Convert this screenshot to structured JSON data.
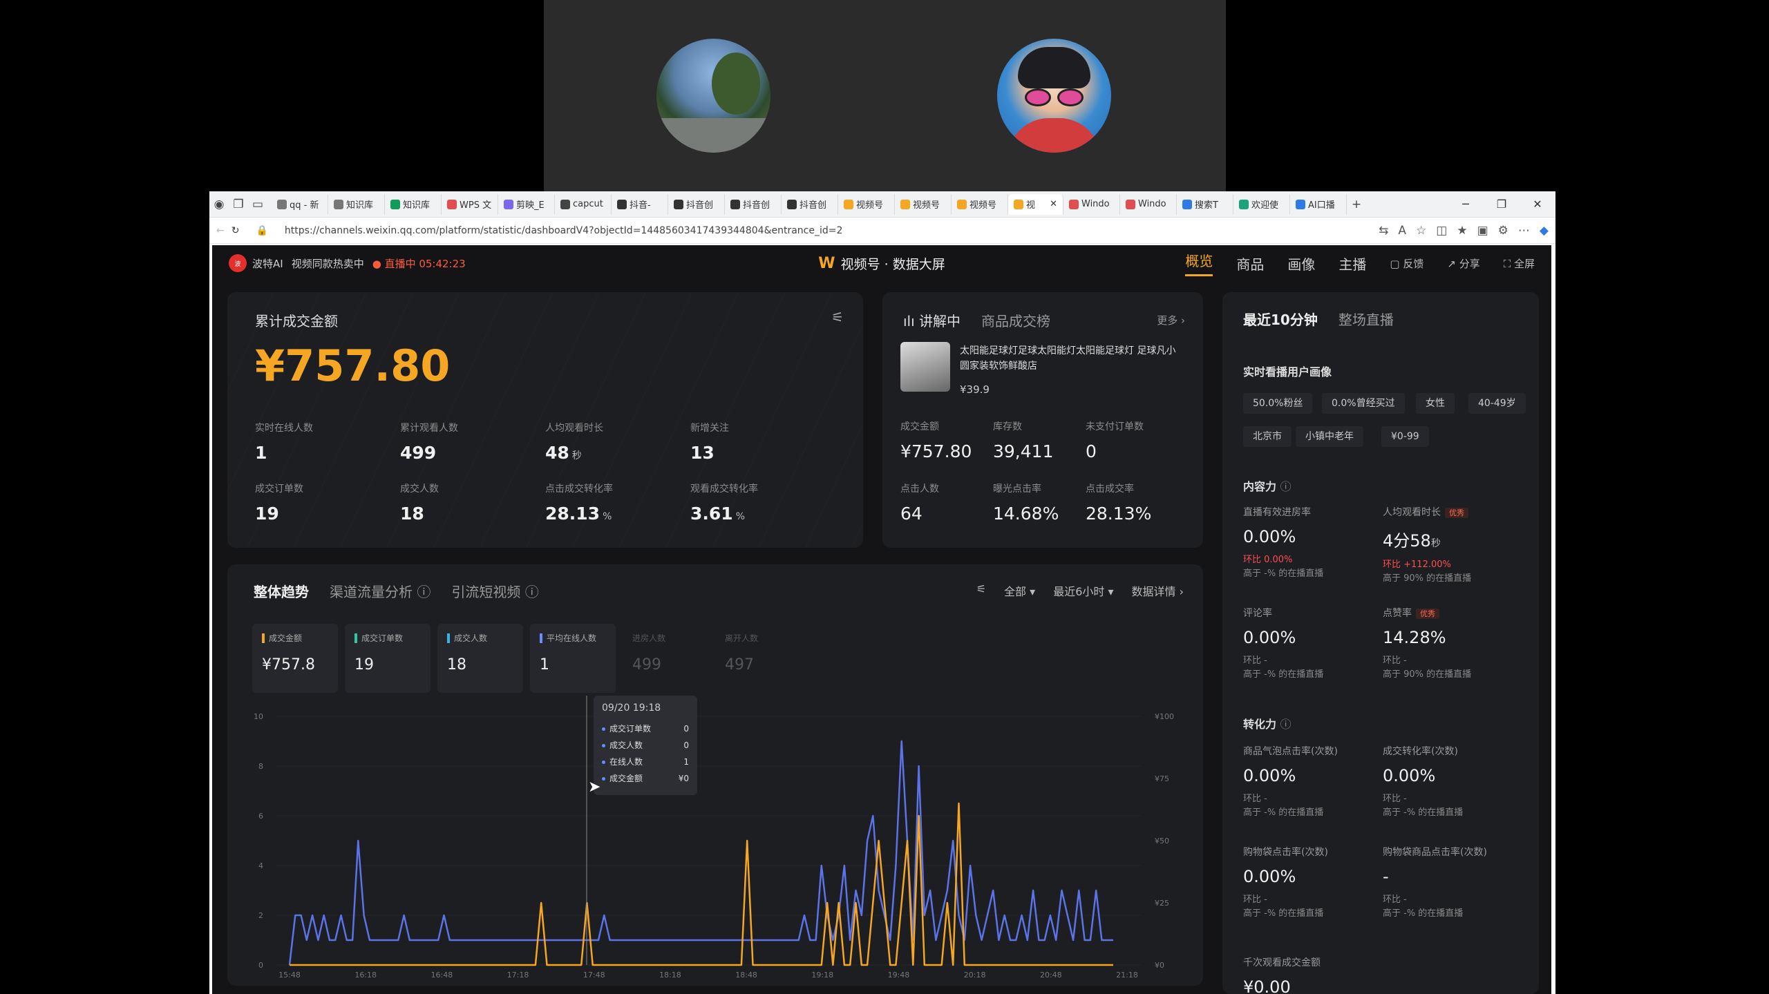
{
  "browser": {
    "tabs": [
      "qq - 新",
      "知识库",
      "知识库",
      "WPS 文",
      "剪映_E",
      "capcut",
      "抖音-",
      "抖音创",
      "抖音创",
      "抖音创",
      "视频号",
      "视频号",
      "视频号",
      "视",
      "Windo",
      "Windo",
      "搜索T",
      "欢迎使",
      "AI口播"
    ],
    "url": "https://channels.weixin.qq.com/platform/statistic/dashboardV4?objectId=14485603417439344804&entrance_id=2"
  },
  "topnav": {
    "brand": "波特AI",
    "status": "视频同款热卖中",
    "live": "直播中 05:42:23",
    "center_title": "视频号 · 数据大屏",
    "nav": [
      "概览",
      "商品",
      "画像",
      "主播"
    ],
    "actions": [
      "反馈",
      "分享",
      "全屏"
    ]
  },
  "sales": {
    "title": "累计成交金额",
    "amount": "¥757.80",
    "metrics": [
      {
        "label": "实时在线人数",
        "value": "1",
        "unit": ""
      },
      {
        "label": "累计观看人数",
        "value": "499",
        "unit": ""
      },
      {
        "label": "人均观看时长",
        "value": "48",
        "unit": "秒"
      },
      {
        "label": "新增关注",
        "value": "13",
        "unit": ""
      },
      {
        "label": "成交订单数",
        "value": "19",
        "unit": ""
      },
      {
        "label": "成交人数",
        "value": "18",
        "unit": ""
      },
      {
        "label": "点击成交转化率",
        "value": "28.13",
        "unit": "%"
      },
      {
        "label": "观看成交转化率",
        "value": "3.61",
        "unit": "%"
      }
    ]
  },
  "product": {
    "tab_active": "讲解中",
    "tab_inactive": "商品成交榜",
    "more": "更多",
    "name": "太阳能足球灯足球太阳能灯太阳能足球灯 足球凡小圆家装软饰鲜酸店",
    "price": "¥39.9",
    "stats": [
      {
        "label": "成交金额",
        "value": "¥757.80"
      },
      {
        "label": "库存数",
        "value": "39,411"
      },
      {
        "label": "未支付订单数",
        "value": "0"
      },
      {
        "label": "点击人数",
        "value": "64"
      },
      {
        "label": "曝光点击率",
        "value": "14.68%"
      },
      {
        "label": "点击成交率",
        "value": "28.13%"
      }
    ]
  },
  "live": {
    "tab_active": "最近10分钟",
    "tab_inactive": "整场直播",
    "portrait_title": "实时看播用户画像",
    "chips": [
      "50.0%粉丝",
      "0.0%曾经买过",
      "女性",
      "40-49岁",
      "北京市",
      "小镇中老年",
      "¥0-99"
    ],
    "content_title": "内容力",
    "content": [
      {
        "label": "直播有效进房率",
        "badge": "",
        "value": "0.00%",
        "unit": "",
        "ring": "环比 0.00%",
        "rank": "高于 -% 的在播直播"
      },
      {
        "label": "人均观看时长",
        "badge": "优秀",
        "value": "4分58",
        "unit": "秒",
        "ring": "环比 +112.00%",
        "rank": "高于 90% 的在播直播"
      },
      {
        "label": "评论率",
        "badge": "",
        "value": "0.00%",
        "unit": "",
        "ring": "环比 -",
        "rank": "高于 -% 的在播直播"
      },
      {
        "label": "点赞率",
        "badge": "优秀",
        "value": "14.28%",
        "unit": "",
        "ring": "环比 -",
        "rank": "高于 90% 的在播直播"
      }
    ],
    "convert_title": "转化力",
    "convert": [
      {
        "label": "商品气泡点击率(次数)",
        "value": "0.00%",
        "ring": "环比 -",
        "rank": "高于 -% 的在播直播"
      },
      {
        "label": "成交转化率(次数)",
        "value": "0.00%",
        "ring": "环比 -",
        "rank": "高于 -% 的在播直播"
      },
      {
        "label": "购物袋点击率(次数)",
        "value": "0.00%",
        "ring": "环比 -",
        "rank": "高于 -% 的在播直播"
      },
      {
        "label": "购物袋商品点击率(次数)",
        "value": "-",
        "ring": "环比 -",
        "rank": "高于 -% 的在播直播"
      }
    ],
    "bottom_label": "千次观看成交金额",
    "bottom_value": "¥0.00"
  },
  "trend": {
    "tabs": [
      "整体趋势",
      "渠道流量分析",
      "引流短视频"
    ],
    "ctrls": [
      "全部",
      "最近6小时",
      "数据详情"
    ],
    "cards": [
      {
        "label": "成交金额",
        "value": "¥757.8",
        "color": "#f5a623"
      },
      {
        "label": "成交订单数",
        "value": "19",
        "color": "#2ec7a4"
      },
      {
        "label": "成交人数",
        "value": "18",
        "color": "#33b5e5"
      },
      {
        "label": "平均在线人数",
        "value": "1",
        "color": "#6a8cff"
      },
      {
        "label": "进房人数",
        "value": "499",
        "color": ""
      },
      {
        "label": "离开人数",
        "value": "497",
        "color": ""
      }
    ],
    "tooltip": {
      "time": "09/20 19:18",
      "rows": [
        {
          "label": "成交订单数",
          "value": "0"
        },
        {
          "label": "成交人数",
          "value": "0"
        },
        {
          "label": "在线人数",
          "value": "1"
        },
        {
          "label": "成交金额",
          "value": "¥0"
        }
      ]
    }
  },
  "chart_data": {
    "type": "line",
    "x": [
      "15:48",
      "16:18",
      "16:48",
      "17:18",
      "17:48",
      "18:18",
      "18:48",
      "19:18",
      "19:48",
      "20:18",
      "20:48",
      "21:18"
    ],
    "ylim_left": [
      0,
      10
    ],
    "yticks_left": [
      0,
      2,
      4,
      6,
      8,
      10
    ],
    "ylim_right": [
      0,
      100
    ],
    "yticks_right": [
      "¥0",
      "¥25",
      "¥50",
      "¥75",
      "¥100"
    ],
    "series": [
      {
        "name": "平均在线人数",
        "axis": "left",
        "color": "#5b73e8",
        "values": [
          0,
          2,
          2,
          1,
          2,
          1,
          2,
          1,
          1,
          2,
          1,
          1,
          5,
          2,
          1,
          1,
          1,
          1,
          1,
          1,
          2,
          1,
          1,
          1,
          1,
          1,
          1,
          2,
          1,
          1,
          1,
          1,
          1,
          1,
          1,
          1,
          1,
          1,
          1,
          1,
          1,
          1,
          1,
          1,
          1,
          1,
          1,
          1,
          1,
          1,
          1,
          1,
          1,
          1,
          1,
          2,
          1,
          1,
          1,
          1,
          1,
          1,
          1,
          1,
          1,
          1,
          1,
          1,
          1,
          1,
          1,
          1,
          1,
          1,
          1,
          1,
          1,
          1,
          1,
          1,
          1,
          1,
          1,
          1,
          1,
          1,
          1,
          1,
          1,
          1,
          2,
          1,
          1,
          4,
          2,
          1,
          2,
          4,
          1,
          3,
          2,
          5,
          6,
          3,
          2,
          1,
          4,
          9,
          5,
          1,
          8,
          2,
          3,
          1,
          2,
          3,
          5,
          2,
          1,
          4,
          2,
          1,
          2,
          3,
          1,
          2,
          1,
          1,
          2,
          1,
          3,
          1,
          1,
          2,
          1,
          3,
          2,
          1,
          3,
          1,
          1,
          3,
          1,
          1,
          1
        ]
      },
      {
        "name": "成交金额",
        "axis": "right",
        "color": "#f5a623",
        "values": [
          0,
          0,
          0,
          0,
          0,
          0,
          0,
          0,
          0,
          0,
          0,
          0,
          0,
          0,
          0,
          0,
          0,
          0,
          0,
          0,
          0,
          0,
          0,
          0,
          0,
          0,
          0,
          0,
          0,
          0,
          0,
          0,
          0,
          0,
          0,
          0,
          0,
          0,
          0,
          0,
          0,
          0,
          0,
          0,
          25,
          0,
          0,
          0,
          0,
          0,
          0,
          0,
          25,
          0,
          0,
          0,
          0,
          0,
          0,
          0,
          0,
          0,
          0,
          0,
          0,
          0,
          0,
          0,
          0,
          0,
          0,
          0,
          0,
          0,
          0,
          0,
          0,
          0,
          0,
          0,
          50,
          0,
          0,
          0,
          0,
          0,
          0,
          0,
          0,
          0,
          0,
          0,
          0,
          0,
          25,
          0,
          25,
          0,
          0,
          25,
          0,
          0,
          25,
          50,
          25,
          0,
          0,
          25,
          50,
          0,
          60,
          0,
          0,
          0,
          0,
          25,
          0,
          65,
          0,
          0,
          0,
          0,
          0,
          0,
          0,
          0,
          0,
          0,
          0,
          0,
          0,
          0,
          0,
          0,
          0,
          0,
          0,
          0,
          0,
          0,
          0,
          0,
          0,
          0,
          0
        ]
      }
    ]
  }
}
